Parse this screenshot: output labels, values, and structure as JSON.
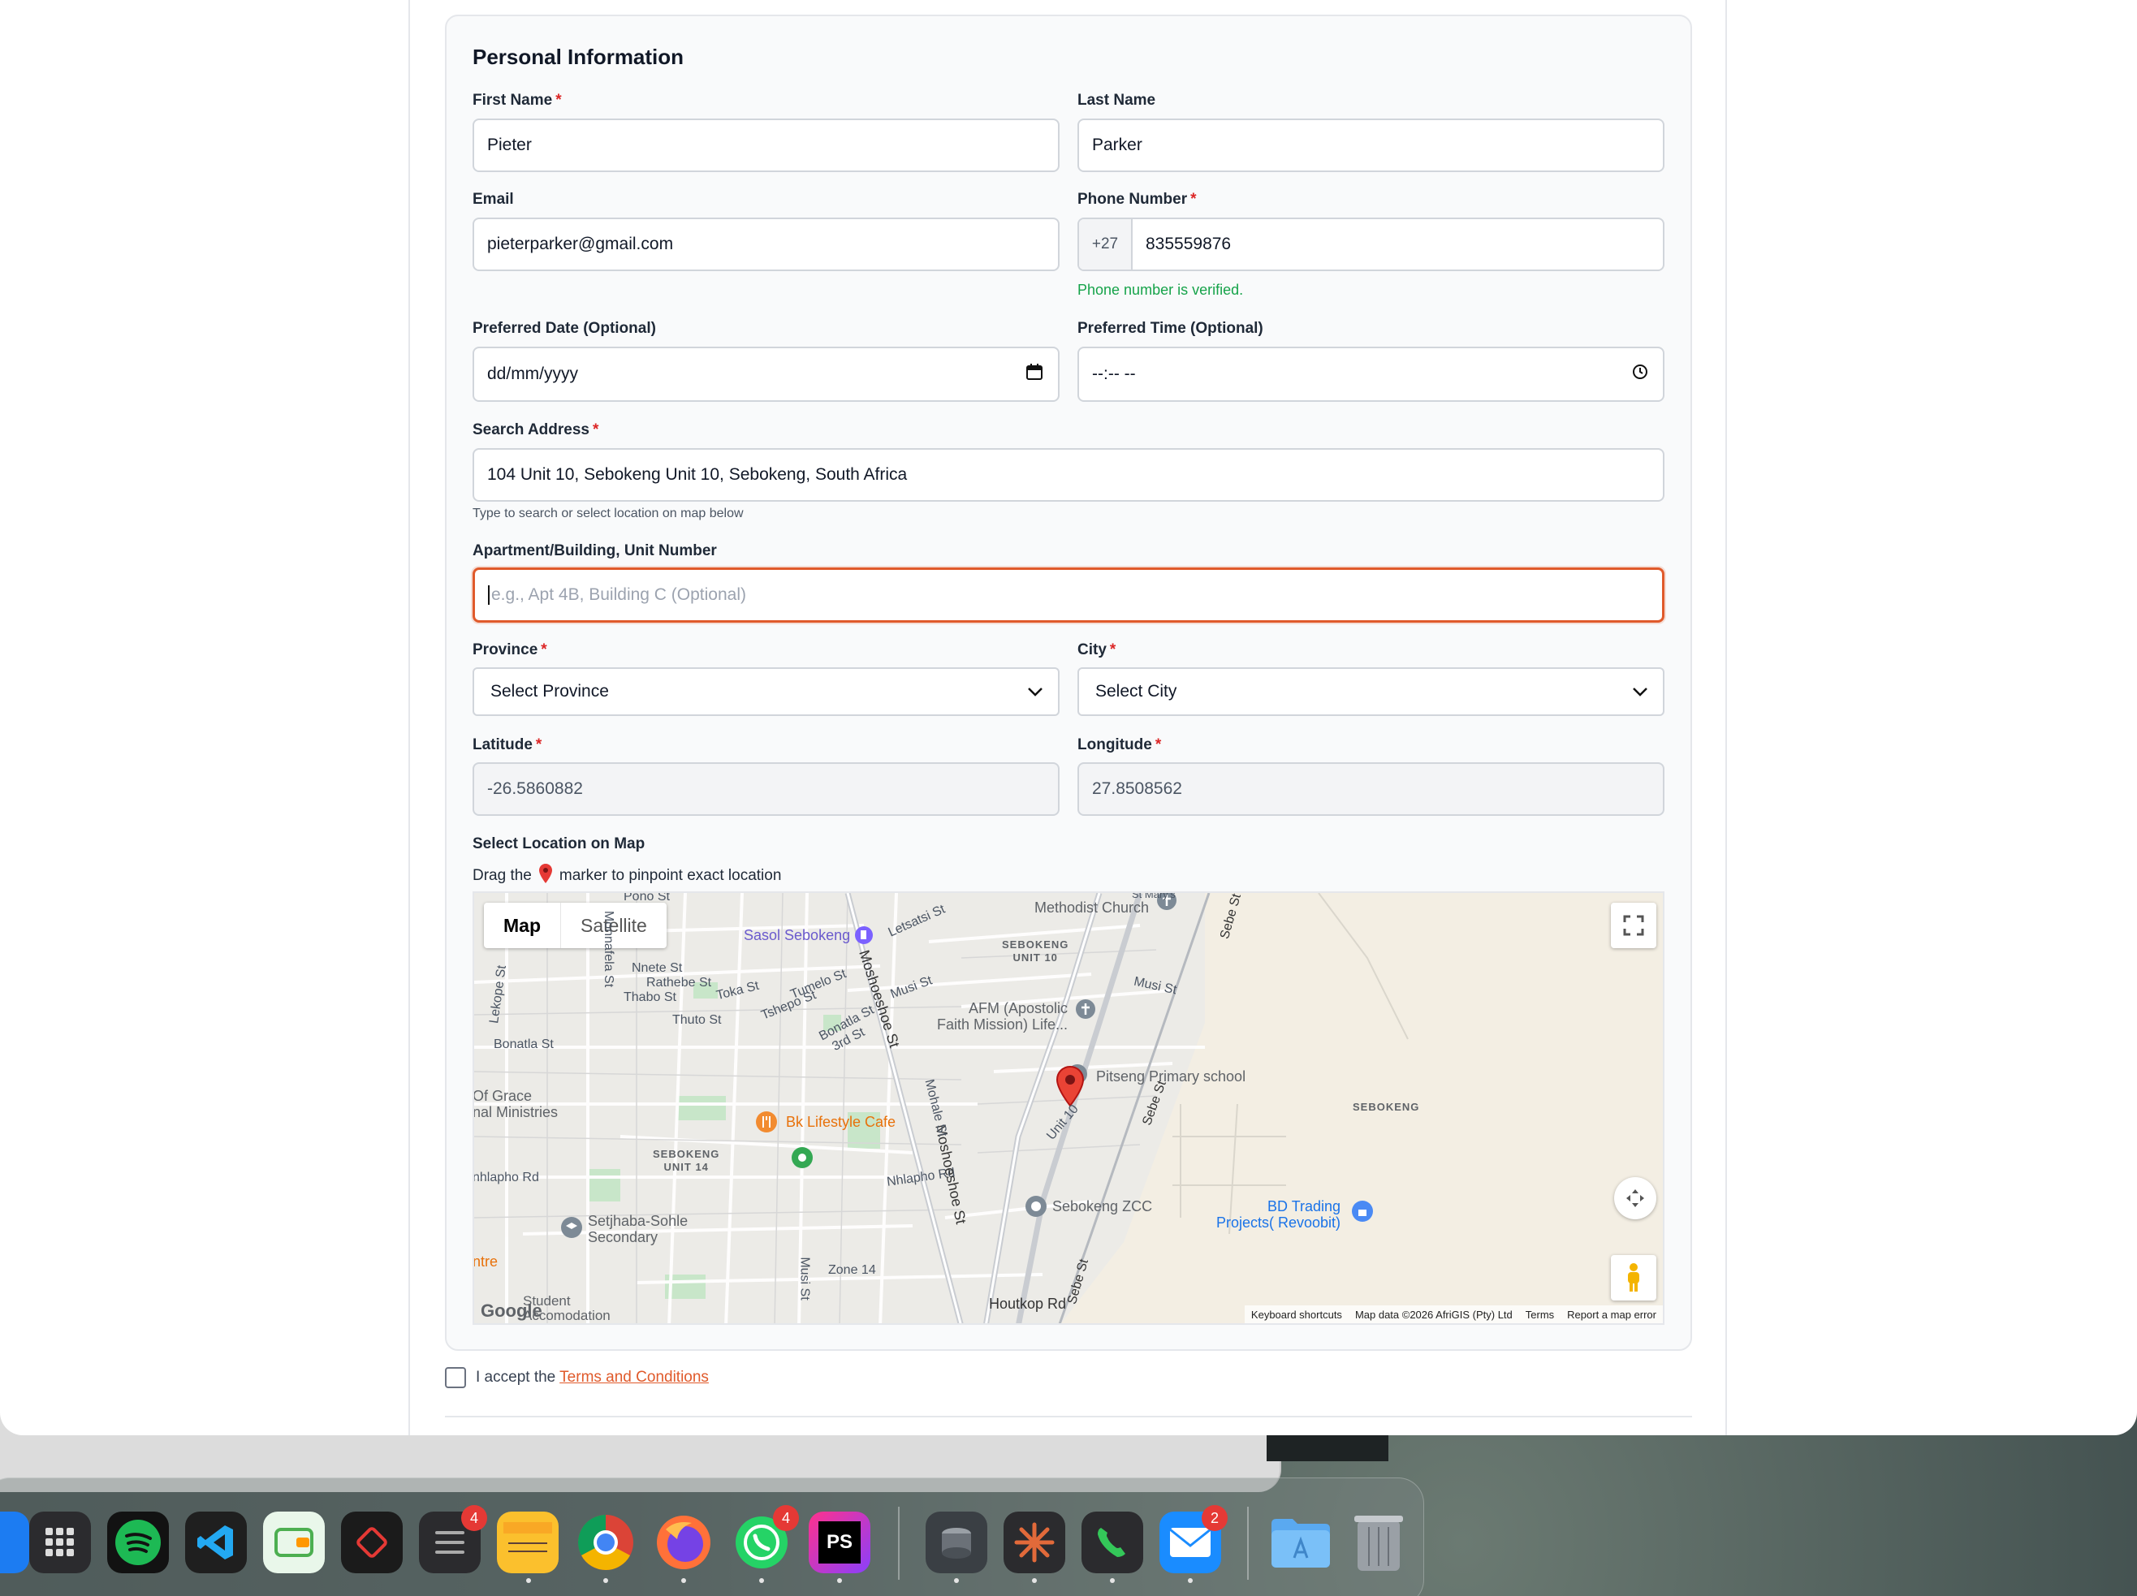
{
  "form": {
    "section_title": "Personal Information",
    "required_mark": "*",
    "first_name": {
      "label": "First Name",
      "value": "Pieter"
    },
    "last_name": {
      "label": "Last Name",
      "value": "Parker"
    },
    "email": {
      "label": "Email",
      "value": "pieterparker@gmail.com"
    },
    "phone": {
      "label": "Phone Number",
      "prefix": "+27",
      "value": "835559876",
      "status": "Phone number is verified."
    },
    "preferred_date": {
      "label": "Preferred Date (Optional)",
      "value": "dd/mm/yyyy"
    },
    "preferred_time": {
      "label": "Preferred Time (Optional)",
      "value": "--:-- --"
    },
    "search_address": {
      "label": "Search Address",
      "value": "104 Unit 10, Sebokeng Unit 10, Sebokeng, South Africa",
      "hint": "Type to search or select location on map below"
    },
    "apartment": {
      "label": "Apartment/Building, Unit Number",
      "placeholder": "e.g., Apt 4B, Building C (Optional)"
    },
    "province": {
      "label": "Province",
      "value": "Select Province"
    },
    "city": {
      "label": "City",
      "value": "Select City"
    },
    "latitude": {
      "label": "Latitude",
      "value": "-26.5860882"
    },
    "longitude": {
      "label": "Longitude",
      "value": "27.8508562"
    },
    "map_section": {
      "label": "Select Location on Map",
      "instruction_before": "Drag the",
      "instruction_after": "marker to pinpoint exact location"
    },
    "terms": {
      "text": "I accept the",
      "link": "Terms and Conditions"
    }
  },
  "map": {
    "type_buttons": {
      "map": "Map",
      "satellite": "Satellite"
    },
    "labels": {
      "sasol": "Sasol Sebokeng",
      "methodist": "Methodist Church",
      "st_marys": "St Mary's",
      "afm": "AFM (Apostolic\nFaith Mission) Life...",
      "pitseng": "Pitseng Primary school",
      "bk_cafe": "Bk Lifestyle Cafe",
      "sebokeng_zcc": "Sebokeng ZCC",
      "bd_trading": "BD Trading\nProjects( Revoobit)",
      "setjhaba": "Setjhaba-Sohle\nSecondary",
      "grace": "Of Grace\nnal Ministries",
      "unit10": "SEBOKENG\nUNIT 10",
      "unit14": "SEBOKENG\nUNIT 14",
      "sebokeng": "SEBOKENG",
      "zone14": "Zone 14",
      "houtkop": "Houtkop Rd",
      "bonatla": "Bonatla St",
      "nhlapho": "Nhlapho Rd",
      "nhlapho2": "nhlapho Rd",
      "thuto": "Thuto St",
      "toka": "Toka St",
      "nnete": "Nnete St",
      "rathebe": "Rathebe St",
      "thabo": "Thabo St",
      "ntre": "ntre",
      "student": "Student\nAccomodation",
      "unit10_road": "Unit 10",
      "lekope": "Lekope St",
      "monnafela": "Monnafela St",
      "moshoeshoe": "Moshoeshoe St",
      "moshoeshoe2": "Moshoeshoe St",
      "sebe1": "Sebe St",
      "sebe2": "Sebe St",
      "sebe3": "Sebe St",
      "musi1": "Musi St",
      "musi2": "Musi St",
      "musi3": "Musi St",
      "tumelo": "Tumelo St",
      "tshepo": "Tshepo St",
      "bonatla2": "Bonatla St",
      "third": "3rd St",
      "letsatsi": "Letsatsi St",
      "mohale": "Mohale St",
      "pono": "Pono St",
      "google": "Google"
    },
    "attribution": [
      "Keyboard shortcuts",
      "Map data ©2026 AfriGIS (Pty) Ltd",
      "Terms",
      "Report a map error"
    ]
  },
  "dock": {
    "badges": {
      "reminders": "4",
      "whatsapp": "4",
      "mail": "2"
    },
    "phpstorm_label": "PS",
    "colors": {
      "spotify": "#1DB954",
      "vscode": "#007ACC",
      "chrome": "#4285F4",
      "whatsapp": "#25D366",
      "mail": "#1a8cff"
    }
  }
}
